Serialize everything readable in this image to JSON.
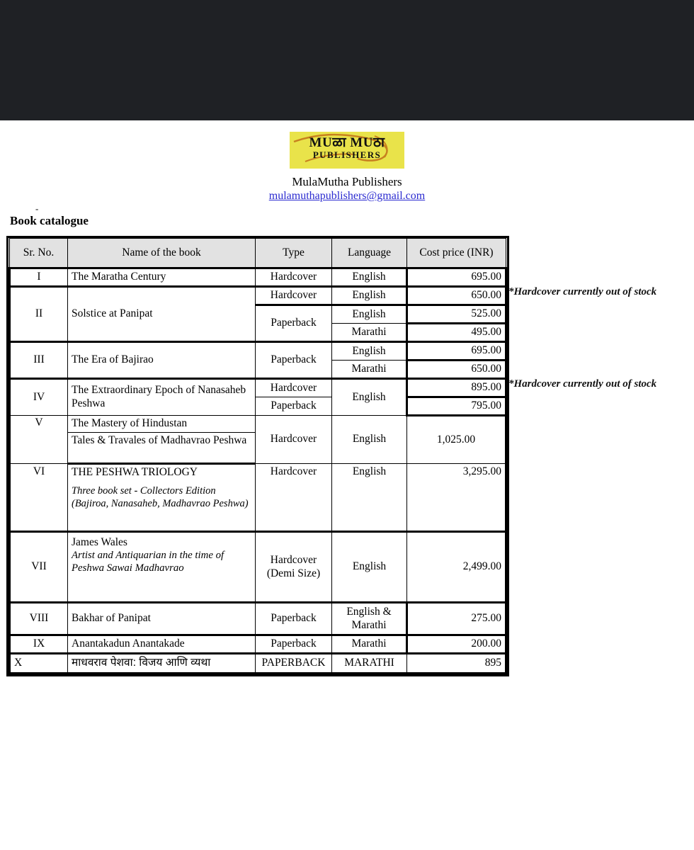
{
  "letterhead": {
    "logo": {
      "line1": "MUळा MUठा",
      "line2": "PUBLISHERS",
      "bg_color": "#e9e34a",
      "swoosh_color": "#c8801f"
    },
    "publisher_name": "MulaMutha Publishers",
    "email": "mulamuthapublishers@gmail.com",
    "email_color": "#2a2ad0"
  },
  "heading": {
    "dash": "-",
    "title": "Book catalogue"
  },
  "table": {
    "columns": [
      "Sr. No.",
      "Name of the book",
      "Type",
      "Language",
      "Cost price (INR)"
    ],
    "rows": [
      {
        "sr": "I",
        "name": "The Maratha Century",
        "lines": [
          {
            "type": "Hardcover",
            "language": "English",
            "cost": "695.00"
          }
        ]
      },
      {
        "sr": "II",
        "name": "Solstice at Panipat",
        "lines": [
          {
            "type": "Hardcover",
            "language": "English",
            "cost": "650.00"
          },
          {
            "type": "Paperback",
            "language": "English",
            "cost": "525.00"
          },
          {
            "type": "",
            "language": "Marathi",
            "cost": "495.00"
          }
        ]
      },
      {
        "sr": "III",
        "name": "The Era of Bajirao",
        "lines": [
          {
            "type": "Paperback",
            "language": "English",
            "cost": "695.00"
          },
          {
            "type": "",
            "language": "Marathi",
            "cost": "650.00"
          }
        ]
      },
      {
        "sr": "IV",
        "name": "The Extraordinary Epoch of Nanasaheb Peshwa",
        "lines": [
          {
            "type": "Hardcover",
            "language": "English",
            "cost": "895.00"
          },
          {
            "type": "Paperback",
            "language": "",
            "cost": "795.00"
          }
        ]
      },
      {
        "sr": "V",
        "name_line_1": "The Mastery of Hindustan",
        "name_line_2": "Tales & Travales of Madhavrao Peshwa",
        "lines": [
          {
            "type": "Hardcover",
            "language": "English",
            "cost": "1,025.00"
          }
        ]
      },
      {
        "sr": "VI",
        "name": "THE PESHWA TRIOLOGY",
        "subtitle": "Three book set - Collectors Edition (Bajiroa, Nanasaheb, Madhavrao Peshwa)",
        "lines": [
          {
            "type": "Hardcover",
            "language": "English",
            "cost": "3,295.00"
          }
        ]
      },
      {
        "sr": "VII",
        "name": "James Wales",
        "subtitle": "Artist and Antiquarian in the time of Peshwa Sawai Madhavrao",
        "lines": [
          {
            "type_line_1": "Hardcover",
            "type_line_2": "(Demi Size)",
            "language": "English",
            "cost": "2,499.00"
          }
        ]
      },
      {
        "sr": "VIII",
        "name": "Bakhar of Panipat",
        "lines": [
          {
            "type": "Paperback",
            "language_line_1": "English &",
            "language_line_2": "Marathi",
            "cost": "275.00"
          }
        ]
      },
      {
        "sr": "IX",
        "name": "Anantakadun Anantakade",
        "lines": [
          {
            "type": "Paperback",
            "language": "Marathi",
            "cost": "200.00"
          }
        ]
      },
      {
        "sr": "X",
        "name": "माधवराव पेशवा: विजय आणि व्यथा",
        "lines": [
          {
            "type": "PAPERBACK",
            "language": "MARATHI",
            "cost": "895"
          }
        ]
      }
    ]
  },
  "notes": {
    "note_1": "*Hardcover currently out of stock",
    "note_2": "*Hardcover currently out of stock"
  }
}
